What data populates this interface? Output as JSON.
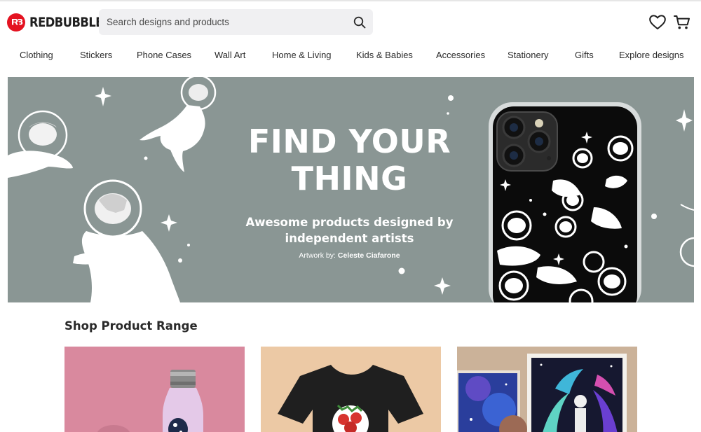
{
  "brand": {
    "name": "REDBUBBLE",
    "logo_icon": "redbubble-logo-icon",
    "color": "#e41321"
  },
  "search": {
    "placeholder": "Search designs and products",
    "icon": "search-icon"
  },
  "header_icons": {
    "wishlist": "heart-icon",
    "cart": "cart-icon"
  },
  "nav": {
    "items": [
      {
        "label": "Clothing"
      },
      {
        "label": "Stickers"
      },
      {
        "label": "Phone Cases"
      },
      {
        "label": "Wall Art"
      },
      {
        "label": "Home & Living"
      },
      {
        "label": "Kids & Babies"
      },
      {
        "label": "Accessories"
      },
      {
        "label": "Stationery"
      },
      {
        "label": "Gifts"
      },
      {
        "label": "Explore designs"
      }
    ]
  },
  "hero": {
    "title_line1": "FIND YOUR",
    "title_line2": "THING",
    "subtitle_line1": "Awesome products designed by",
    "subtitle_line2": "independent artists",
    "credit_label": "Artwork by:",
    "credit_artist": "Celeste Ciafarone",
    "background_color": "#8a9694"
  },
  "product_range": {
    "title": "Shop Product Range",
    "cards": [
      {
        "image": "water-bottle-image",
        "bg": "#d9899e"
      },
      {
        "image": "t-shirt-image",
        "bg": "#ecc9a5"
      },
      {
        "image": "art-prints-image",
        "bg": "#cbb299"
      }
    ]
  }
}
